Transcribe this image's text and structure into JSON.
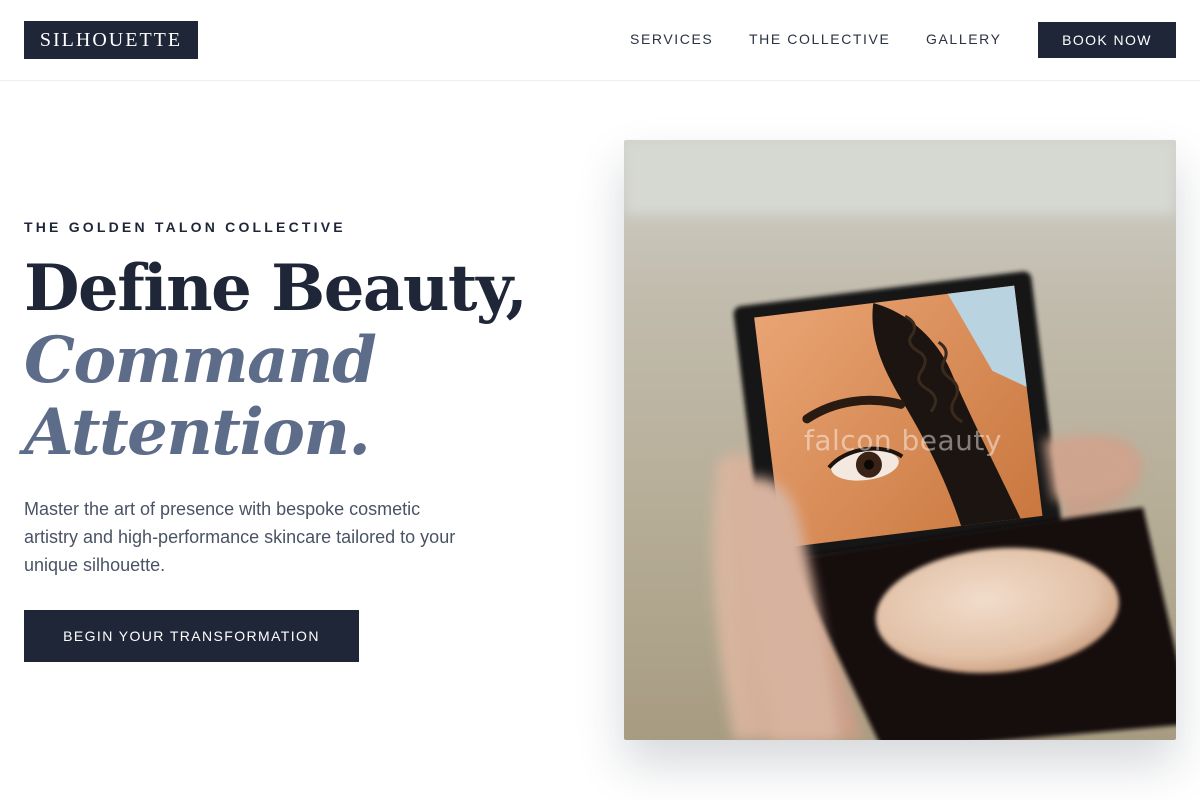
{
  "brand": {
    "logo_text": "SILHOUETTE"
  },
  "nav": {
    "items": [
      {
        "label": "SERVICES"
      },
      {
        "label": "THE COLLECTIVE"
      },
      {
        "label": "GALLERY"
      }
    ],
    "book_label": "BOOK NOW"
  },
  "hero": {
    "eyebrow": "THE GOLDEN TALON COLLECTIVE",
    "headline_line1": "Define Beauty,",
    "headline_line2": "Command",
    "headline_line3": "Attention.",
    "lead": "Master the art of presence with bespoke cosmetic artistry and high-performance skincare tailored to your unique silhouette.",
    "cta_label": "BEGIN YOUR TRANSFORMATION",
    "image_watermark": "falcon beauty"
  },
  "colors": {
    "primary": "#1e2638",
    "accent": "#5d6c89",
    "body_text": "#4a5365",
    "background": "#ffffff"
  }
}
